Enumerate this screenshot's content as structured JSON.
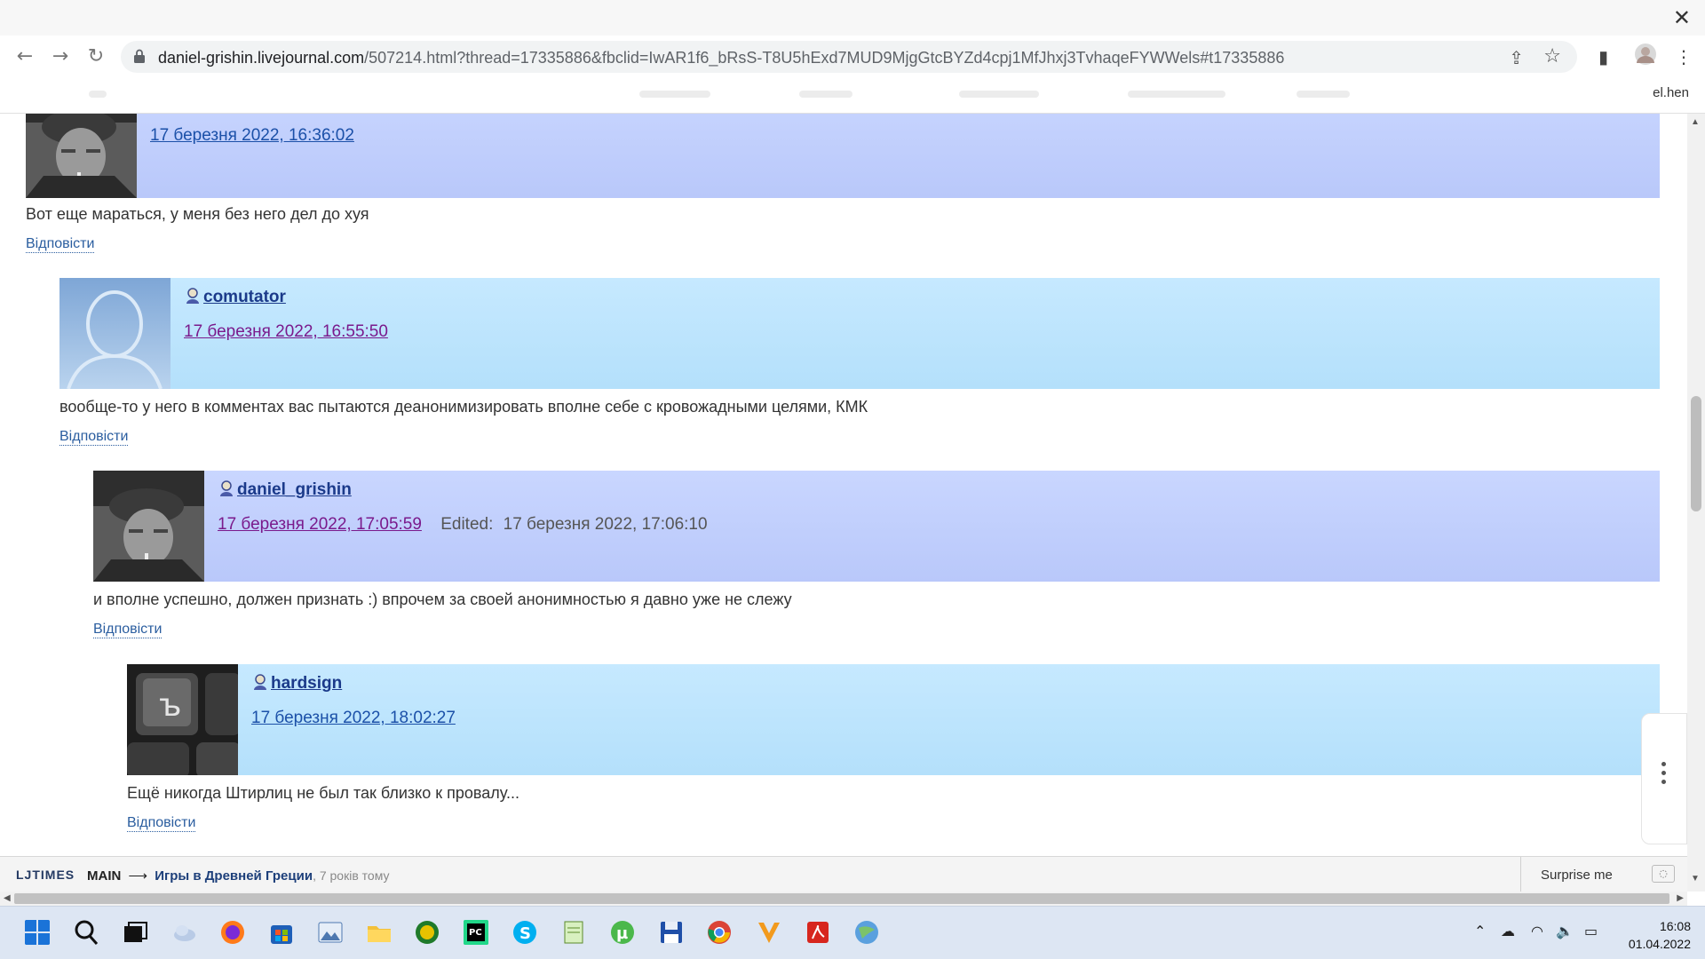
{
  "browser": {
    "url_host": "daniel-grishin.livejournal.com",
    "url_path": "/507214.html?thread=17335886&fbclid=IwAR1f6_bRsS-T8U5hExd7MUD9MjgGtcBYZd4cpj1MfJhxj3TvhaqeFYWWels#t17335886",
    "bookmark_end_text": "el.hen"
  },
  "comments": [
    {
      "username": "",
      "date": "17 березня 2022, 16:36:02",
      "edited_label": "",
      "edited_date": "",
      "body": "Вот еще мараться, у меня без него дел до хуя",
      "reply": "Відповісти",
      "header_color": "blue"
    },
    {
      "username": "comutator",
      "date": "17 березня 2022, 16:55:50",
      "edited_label": "",
      "edited_date": "",
      "body": "вообще-то у него в комментах вас пытаются деанонимизировать вполне себе с кровожадными целями, КМК",
      "reply": "Відповісти",
      "header_color": "cyan"
    },
    {
      "username": "daniel_grishin",
      "date": "17 березня 2022, 17:05:59",
      "edited_label": "Edited:",
      "edited_date": "17 березня 2022, 17:06:10",
      "body": "и вполне успешно, должен признать :) впрочем за своей анонимностью я давно уже не слежу",
      "reply": "Відповісти",
      "header_color": "blue"
    },
    {
      "username": "hardsign",
      "date": "17 березня 2022, 18:02:27",
      "edited_label": "",
      "edited_date": "",
      "body": "Ещё никогда Штирлиц не был так близко к провалу...",
      "reply": "Відповісти",
      "header_color": "cyan"
    }
  ],
  "ljtimes": {
    "logo": "LJTIMES",
    "main": "MAIN",
    "arrow": "⟶",
    "post_title": "Игры в Древней Греции",
    "ago": ", 7 років тому",
    "surprise": "Surprise me"
  },
  "taskbar": {
    "time": "16:08",
    "date": "01.04.2022",
    "apps": [
      "start-icon",
      "search-icon",
      "task-view-icon",
      "weather-icon",
      "firefox-icon",
      "store-icon",
      "photos-icon",
      "file-explorer-icon",
      "globe-app-icon",
      "pycharm-icon",
      "skype-icon",
      "notepad-plus-icon",
      "utorrent-icon",
      "save-app-icon",
      "chrome-icon",
      "vivaldi-icon",
      "acrobat-icon",
      "network-globe-icon"
    ]
  }
}
